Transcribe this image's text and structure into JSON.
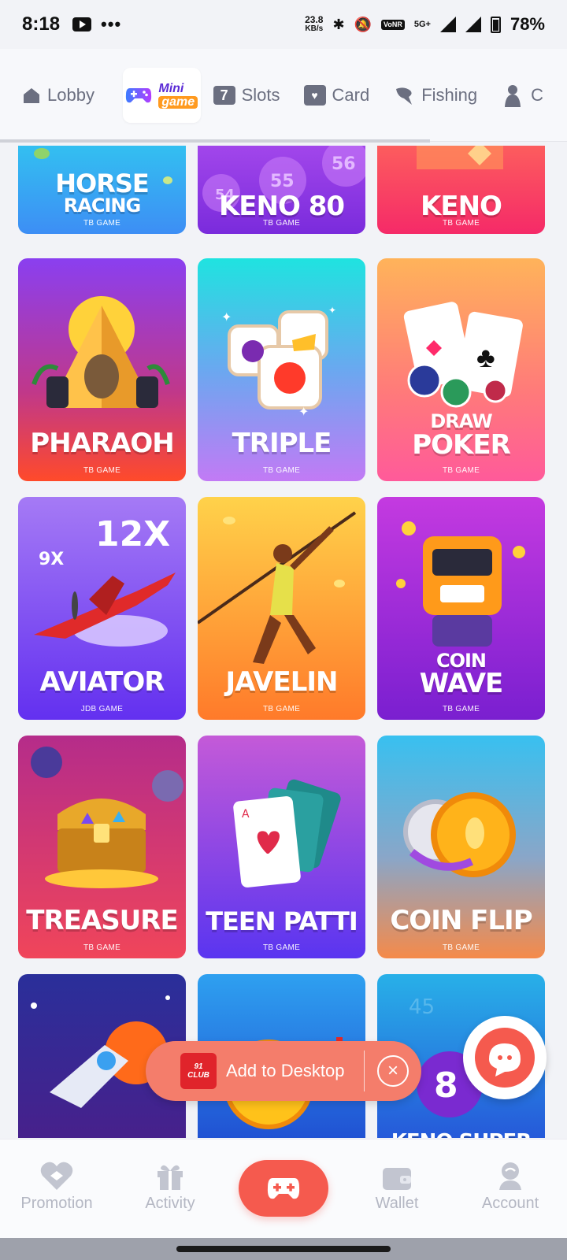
{
  "status_bar": {
    "time": "8:18",
    "more": "•••",
    "net_speed_value": "23.8",
    "net_speed_unit": "KB/s",
    "vonr": "VoNR",
    "network": "5G+",
    "battery": "78%"
  },
  "tabs": [
    {
      "label": "Lobby",
      "icon": "house-icon",
      "active": false
    },
    {
      "label": "Mini game",
      "logo_top": "Mini",
      "logo_bottom": "game",
      "icon": "gamepad-icon",
      "active": true
    },
    {
      "label": "Slots",
      "icon": "slot-seven-icon",
      "active": false
    },
    {
      "label": "Card",
      "icon": "playing-card-icon",
      "active": false
    },
    {
      "label": "Fishing",
      "icon": "fish-icon",
      "active": false
    },
    {
      "label": "C",
      "icon": "figure-icon",
      "active": false
    }
  ],
  "games": [
    {
      "name_lines": [
        "HORSE",
        "RACING"
      ],
      "provider": "TB GAME",
      "colors": [
        "#2fd1ef",
        "#3d8ef5"
      ]
    },
    {
      "name_lines": [
        "KENO 80"
      ],
      "provider": "TB GAME",
      "colors": [
        "#b050f0",
        "#7a2bdc"
      ],
      "balls": [
        "54",
        "55",
        "56"
      ]
    },
    {
      "name_lines": [
        "KENO"
      ],
      "provider": "TB GAME",
      "colors": [
        "#ff6f5a",
        "#f52a68"
      ]
    },
    {
      "name_lines": [
        "PHARAOH"
      ],
      "provider": "TB GAME",
      "colors": [
        "#8a3ff0",
        "#ff4a2a"
      ]
    },
    {
      "name_lines": [
        "TRIPLE"
      ],
      "provider": "TB GAME",
      "colors": [
        "#1fe3e0",
        "#c27af5"
      ]
    },
    {
      "name_lines": [
        "DRAW",
        "POKER"
      ],
      "provider": "TB GAME",
      "colors": [
        "#ffb35a",
        "#ff5a9a"
      ]
    },
    {
      "name_lines": [
        "AVIATOR"
      ],
      "provider": "JDB GAME",
      "colors": [
        "#a57af5",
        "#6330f0"
      ],
      "multipliers": [
        "12X",
        "9X"
      ]
    },
    {
      "name_lines": [
        "JAVELIN"
      ],
      "provider": "TB GAME",
      "colors": [
        "#ffc94a",
        "#ff7a2a"
      ]
    },
    {
      "name_lines": [
        "COIN",
        "WAVE"
      ],
      "provider": "TB GAME",
      "colors": [
        "#c43ae0",
        "#7a1fd0"
      ]
    },
    {
      "name_lines": [
        "TREASURE"
      ],
      "provider": "TB GAME",
      "colors": [
        "#b52c8a",
        "#f0455a"
      ]
    },
    {
      "name_lines": [
        "TEEN PATTI"
      ],
      "provider": "TB GAME",
      "colors": [
        "#c45ad8",
        "#5a35f0"
      ]
    },
    {
      "name_lines": [
        "COIN FLIP"
      ],
      "provider": "TB GAME",
      "colors": [
        "#38c0f0",
        "#f58a4a"
      ]
    },
    {
      "name_lines": [
        ""
      ],
      "provider": "",
      "colors": [
        "#2a2f9a",
        "#4a1f8a"
      ]
    },
    {
      "name_lines": [
        ""
      ],
      "provider": "",
      "colors": [
        "#2ea0f0",
        "#1f4ad0"
      ]
    },
    {
      "name_lines": [
        "KENO SUPER"
      ],
      "provider": "",
      "colors": [
        "#28b0e8",
        "#2550d8"
      ],
      "ball": "8"
    }
  ],
  "add_to_desktop": {
    "text": "Add to Desktop",
    "logo_line1": "91",
    "logo_line2": "CLUB",
    "close": "×"
  },
  "bottom_nav": [
    {
      "label": "Promotion",
      "icon": "promotion-icon"
    },
    {
      "label": "Activity",
      "icon": "gift-icon"
    },
    {
      "label": "",
      "icon": "gamepad-icon",
      "center": true
    },
    {
      "label": "Wallet",
      "icon": "wallet-icon"
    },
    {
      "label": "Account",
      "icon": "account-icon"
    }
  ]
}
